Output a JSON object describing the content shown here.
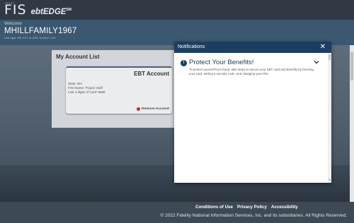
{
  "brand": {
    "logo_text": "FIS",
    "product": "ebtEDGE",
    "trademark": "SM"
  },
  "welcome": {
    "label": "Welcome",
    "username": "MHILLFAMILY1967",
    "last_login": "Last login: FRI OCT 21 2022 10:08:07 CDT"
  },
  "account_list": {
    "title": "My Account List",
    "card": {
      "heading": "EBT Account",
      "state": "State: WA",
      "first_name": "First Name: Project Staff",
      "last4": "Last 4 digits of Card: 9688",
      "remove_label": "Remove Account"
    }
  },
  "modal": {
    "title": "Notifications",
    "close_icon": "close-icon",
    "alert": {
      "icon": "alert-icon",
      "title": "Protect Your Benefits!",
      "body": "To protect yourself from fraud, take steps to secure your EBT card and benefits by freezing your card, setting a security code, and changing your PIN."
    }
  },
  "footer": {
    "links": [
      "Conditions of Use",
      "Privacy Policy",
      "Accessibility"
    ],
    "copyright": "© 2022 Fidelity National Information Services, Inc. and its subsidiaries. All Rights Reserved."
  },
  "colors": {
    "header_bg": "#2f3a44",
    "welcome_bg": "#3a5870",
    "modal_header": "#1d3e60",
    "remove_icon": "#c62828"
  }
}
